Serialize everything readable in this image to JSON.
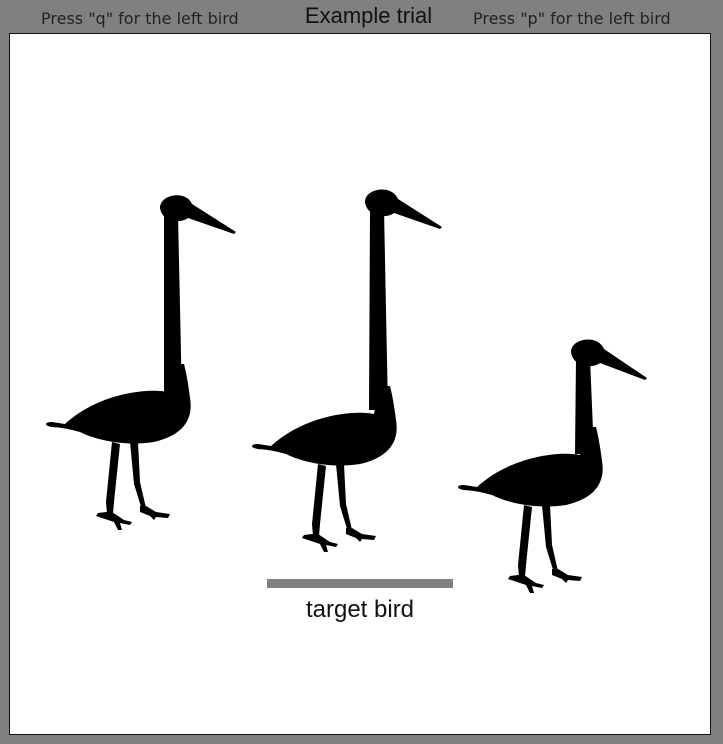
{
  "header": {
    "left_hint": "Press \"q\" for the left bird",
    "title": "Example trial",
    "right_hint": "Press \"p\" for the left bird"
  },
  "stage": {
    "target_label": "target bird"
  },
  "colors": {
    "page_background": "#808080",
    "stage_background": "#ffffff",
    "bird": "#000000",
    "target_bar": "#808080"
  },
  "icons": {
    "bird": "wading-bird-silhouette"
  }
}
